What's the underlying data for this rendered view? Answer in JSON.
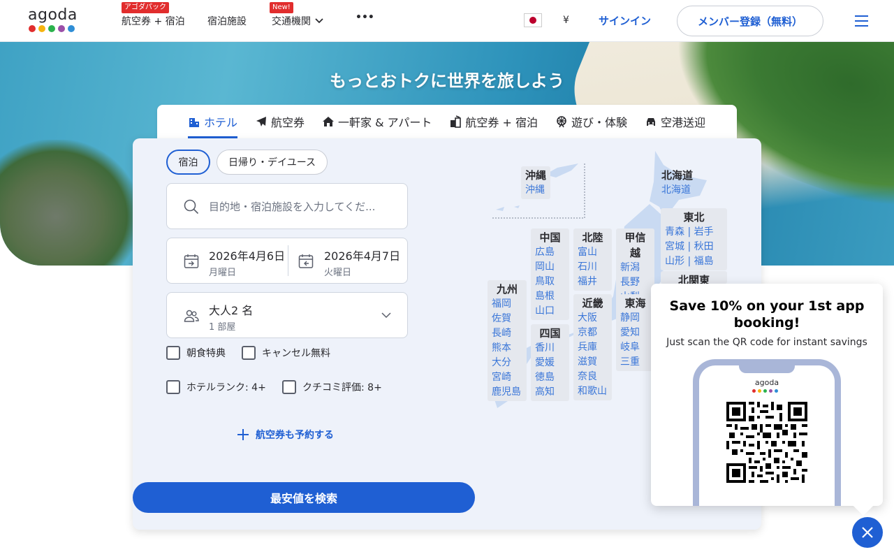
{
  "header": {
    "logo_text": "agoda",
    "logo_colors": [
      "#e12d2d",
      "#f6b30e",
      "#2bb24c",
      "#9b4fa8",
      "#2f8ed6"
    ],
    "nav": [
      {
        "label": "航空券 + 宿泊",
        "badge": "アゴダパック"
      },
      {
        "label": "宿泊施設",
        "badge": ""
      },
      {
        "label": "交通機関",
        "badge": "New!"
      },
      {
        "label": "•••",
        "badge": ""
      }
    ],
    "currency": "¥",
    "signin": "サインイン",
    "register": "メンバー登録（無料）"
  },
  "hero": {
    "title": "もっとおトクに世界を旅しよう"
  },
  "tabs": [
    {
      "label": "ホテル",
      "icon": "hotel-icon"
    },
    {
      "label": "航空券",
      "icon": "airplane-icon"
    },
    {
      "label": "一軒家 & アパート",
      "icon": "house-icon"
    },
    {
      "label": "航空券 + 宿泊",
      "icon": "package-icon"
    },
    {
      "label": "遊び・体験",
      "icon": "ferris-wheel-icon"
    },
    {
      "label": "空港送迎",
      "icon": "car-icon"
    }
  ],
  "search": {
    "stay_types": [
      "宿泊",
      "日帰り・デイユース"
    ],
    "destination_placeholder": "目的地・宿泊施設を入力してくだ...",
    "checkin_date": "2026年4月6日",
    "checkin_day": "月曜日",
    "checkout_date": "2026年4月7日",
    "checkout_day": "火曜日",
    "guests": "大人2 名",
    "rooms": "1 部屋",
    "filters": [
      "朝食特典",
      "キャンセル無料",
      "ホテルランク: 4+",
      "クチコミ評価: 8+"
    ],
    "add_flight": "航空券も予約する",
    "submit": "最安値を検索"
  },
  "map": {
    "regions": [
      {
        "name": "沖縄",
        "prefs": [
          "沖縄"
        ]
      },
      {
        "name": "北海道",
        "prefs": [
          "北海道"
        ]
      },
      {
        "name": "東北",
        "prefs": [
          "青森",
          "岩手",
          "宮城",
          "秋田",
          "山形",
          "福島"
        ]
      },
      {
        "name": "北関東",
        "prefs": []
      },
      {
        "name": "中国",
        "prefs": [
          "広島",
          "岡山",
          "鳥取",
          "島根",
          "山口"
        ]
      },
      {
        "name": "北陸",
        "prefs": [
          "富山",
          "石川",
          "福井"
        ]
      },
      {
        "name": "甲信越",
        "prefs": [
          "新潟",
          "長野",
          "山梨"
        ]
      },
      {
        "name": "九州",
        "prefs": [
          "福岡",
          "佐賀",
          "長崎",
          "熊本",
          "大分",
          "宮崎",
          "鹿児島"
        ]
      },
      {
        "name": "近畿",
        "prefs": [
          "大阪",
          "京都",
          "兵庫",
          "滋賀",
          "奈良",
          "和歌山"
        ]
      },
      {
        "name": "東海",
        "prefs": [
          "静岡",
          "愛知",
          "岐阜",
          "三重"
        ]
      },
      {
        "name": "四国",
        "prefs": [
          "香川",
          "愛媛",
          "徳島",
          "高知"
        ]
      }
    ]
  },
  "promo": {
    "title": "Save 10% on your 1st app booking!",
    "subtitle": "Just scan the QR code for instant savings",
    "phone_logo": "agoda"
  }
}
